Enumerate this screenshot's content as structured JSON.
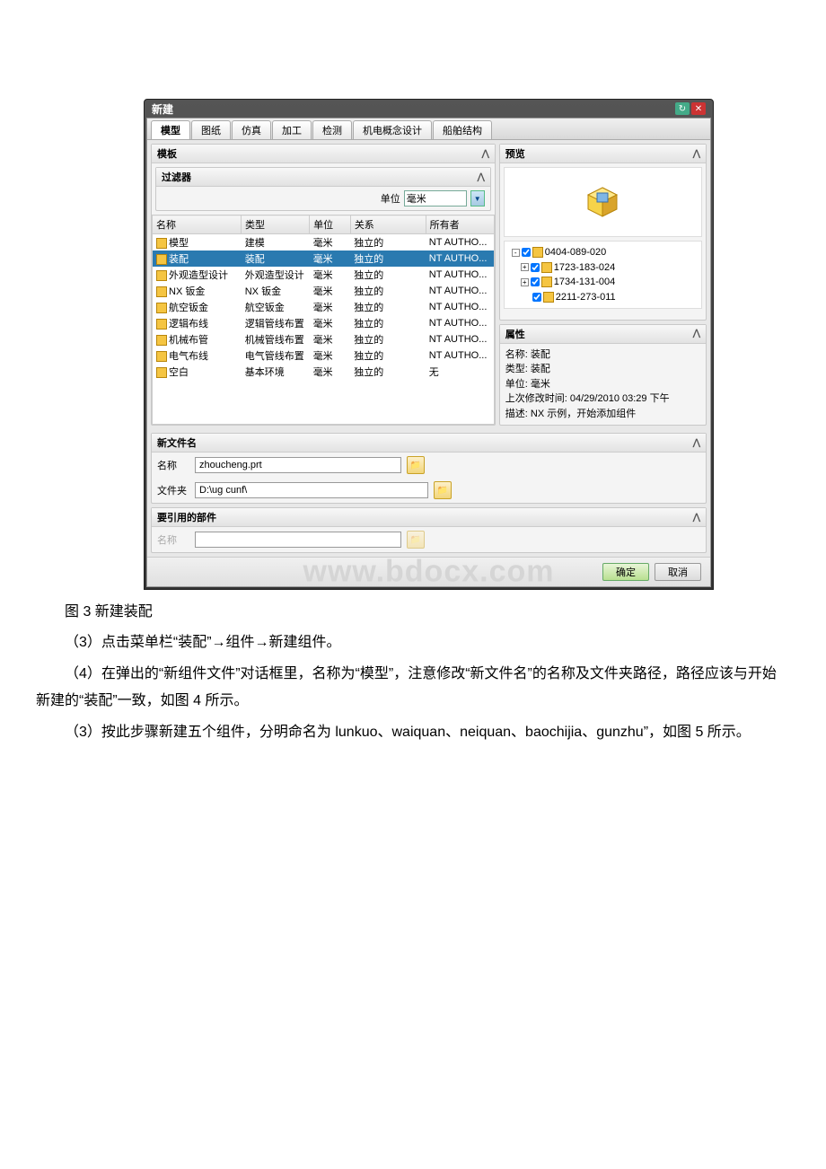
{
  "dialog": {
    "title": "新建",
    "tabs": [
      "模型",
      "图纸",
      "仿真",
      "加工",
      "检测",
      "机电概念设计",
      "船舶结构"
    ],
    "active_tab": "模型",
    "template_section": "模板",
    "filter_section": "过滤器",
    "unit_label": "单位",
    "unit_value": "毫米",
    "columns": {
      "name": "名称",
      "type": "类型",
      "unit": "单位",
      "relation": "关系",
      "owner": "所有者"
    },
    "rows": [
      {
        "name": "模型",
        "type": "建模",
        "unit": "毫米",
        "relation": "独立的",
        "owner": "NT AUTHO..."
      },
      {
        "name": "装配",
        "type": "装配",
        "unit": "毫米",
        "relation": "独立的",
        "owner": "NT AUTHO...",
        "selected": true
      },
      {
        "name": "外观造型设计",
        "type": "外观造型设计",
        "unit": "毫米",
        "relation": "独立的",
        "owner": "NT AUTHO..."
      },
      {
        "name": "NX 钣金",
        "type": "NX 钣金",
        "unit": "毫米",
        "relation": "独立的",
        "owner": "NT AUTHO..."
      },
      {
        "name": "航空钣金",
        "type": "航空钣金",
        "unit": "毫米",
        "relation": "独立的",
        "owner": "NT AUTHO..."
      },
      {
        "name": "逻辑布线",
        "type": "逻辑管线布置",
        "unit": "毫米",
        "relation": "独立的",
        "owner": "NT AUTHO..."
      },
      {
        "name": "机械布管",
        "type": "机械管线布置",
        "unit": "毫米",
        "relation": "独立的",
        "owner": "NT AUTHO..."
      },
      {
        "name": "电气布线",
        "type": "电气管线布置",
        "unit": "毫米",
        "relation": "独立的",
        "owner": "NT AUTHO..."
      },
      {
        "name": "空白",
        "type": "基本环境",
        "unit": "毫米",
        "relation": "独立的",
        "owner": "无"
      }
    ],
    "preview_section": "预览",
    "tree": [
      {
        "level": 0,
        "toggle": "-",
        "label": "0404-089-020"
      },
      {
        "level": 1,
        "toggle": "+",
        "label": "1723-183-024"
      },
      {
        "level": 1,
        "toggle": "+",
        "label": "1734-131-004"
      },
      {
        "level": 1,
        "toggle": "",
        "label": "2211-273-011"
      }
    ],
    "attributes_section": "属性",
    "attr_name_label": "名称:",
    "attr_name_value": "装配",
    "attr_type_label": "类型:",
    "attr_type_value": "装配",
    "attr_unit_label": "单位:",
    "attr_unit_value": "毫米",
    "attr_modified_label": "上次修改时间:",
    "attr_modified_value": "04/29/2010 03:29 下午",
    "attr_desc_label": "描述:",
    "attr_desc_value": "NX 示例，开始添加组件",
    "new_filename_section": "新文件名",
    "name_label": "名称",
    "name_value": "zhoucheng.prt",
    "folder_label": "文件夹",
    "folder_value": "D:\\ug cunf\\",
    "ref_part_section": "要引用的部件",
    "ref_name_label": "名称",
    "ref_name_value": "",
    "ok": "确定",
    "cancel": "取消"
  },
  "watermark": "www.bdocx.com",
  "doc": {
    "caption": "图 3 新建装配",
    "p1": "（3）点击菜单栏“装配”→组件→新建组件。",
    "p2": "（4）在弹出的“新组件文件”对话框里，名称为“模型”，注意修改“新文件名”的名称及文件夹路径，路径应该与开始新建的“装配”一致，如图 4 所示。",
    "p3": "（3）按此步骤新建五个组件，分明命名为 lunkuo、waiquan、neiquan、baochijia、gunzhu”，如图 5 所示。"
  }
}
